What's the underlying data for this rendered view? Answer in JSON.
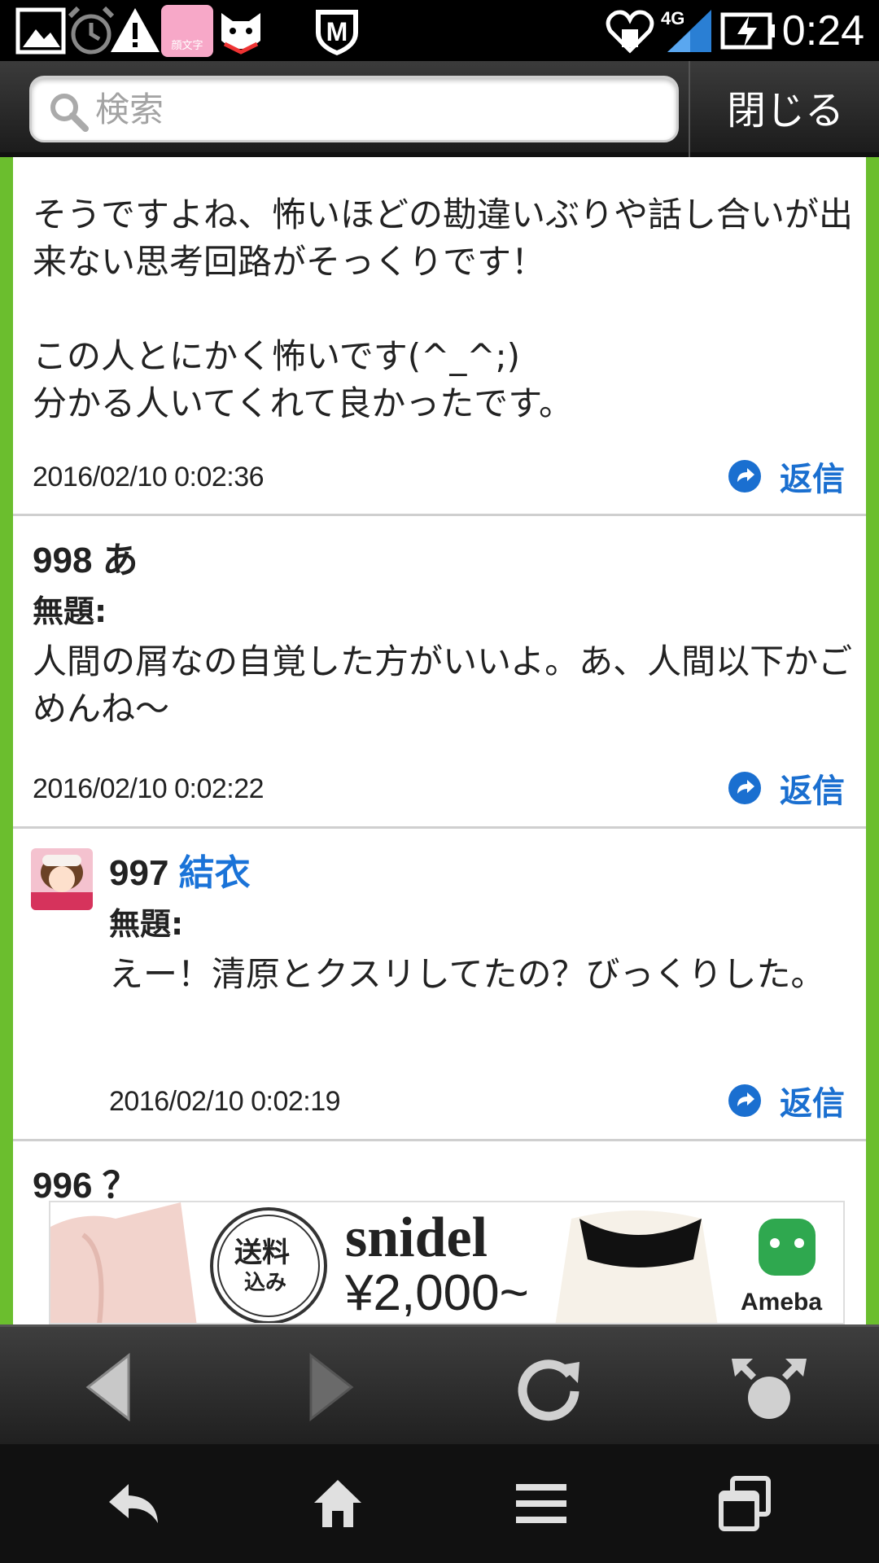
{
  "status_bar": {
    "time": "0:24",
    "network": "4G",
    "icons": [
      "gallery-icon",
      "alarm-icon",
      "warning-icon",
      "kaomoji-app-icon",
      "dog-app-icon",
      "shield-m-icon",
      "heart-notification-icon",
      "signal-icon",
      "battery-charging-icon"
    ],
    "kaomoji_label": "顔文字"
  },
  "search": {
    "placeholder": "検索",
    "close_label": "閉じる"
  },
  "posts": [
    {
      "text": "そうですよね、怖いほどの勘違いぶりや話し合いが出来ない思考回路がそっくりです！\n\nこの人とにかく怖いです(^_^;)\n分かる人いてくれて良かったです。",
      "date": "2016/02/10 0:02:36",
      "reply_label": "返信"
    },
    {
      "number": "998",
      "name": "あ",
      "title": "無題:",
      "text": "人間の屑なの自覚した方がいいよ。あ、人間以下かごめんね〜",
      "date": "2016/02/10 0:02:22",
      "reply_label": "返信"
    },
    {
      "number": "997",
      "name": "結衣",
      "title": "無題:",
      "text": "えー！清原とクスリしてたの？びっくりした。",
      "date": "2016/02/10 0:02:19",
      "reply_label": "返信"
    },
    {
      "number": "996",
      "name": "？"
    }
  ],
  "ad": {
    "badge_top": "送料",
    "badge_bottom": "込み",
    "brand": "snidel",
    "price": "¥2,000~",
    "sponsor": "Ameba"
  },
  "browser_nav": [
    "back-arrow-icon",
    "forward-arrow-icon",
    "reload-icon",
    "share-icon"
  ],
  "system_nav": [
    "back-icon",
    "home-icon",
    "menu-icon",
    "recent-apps-icon"
  ]
}
